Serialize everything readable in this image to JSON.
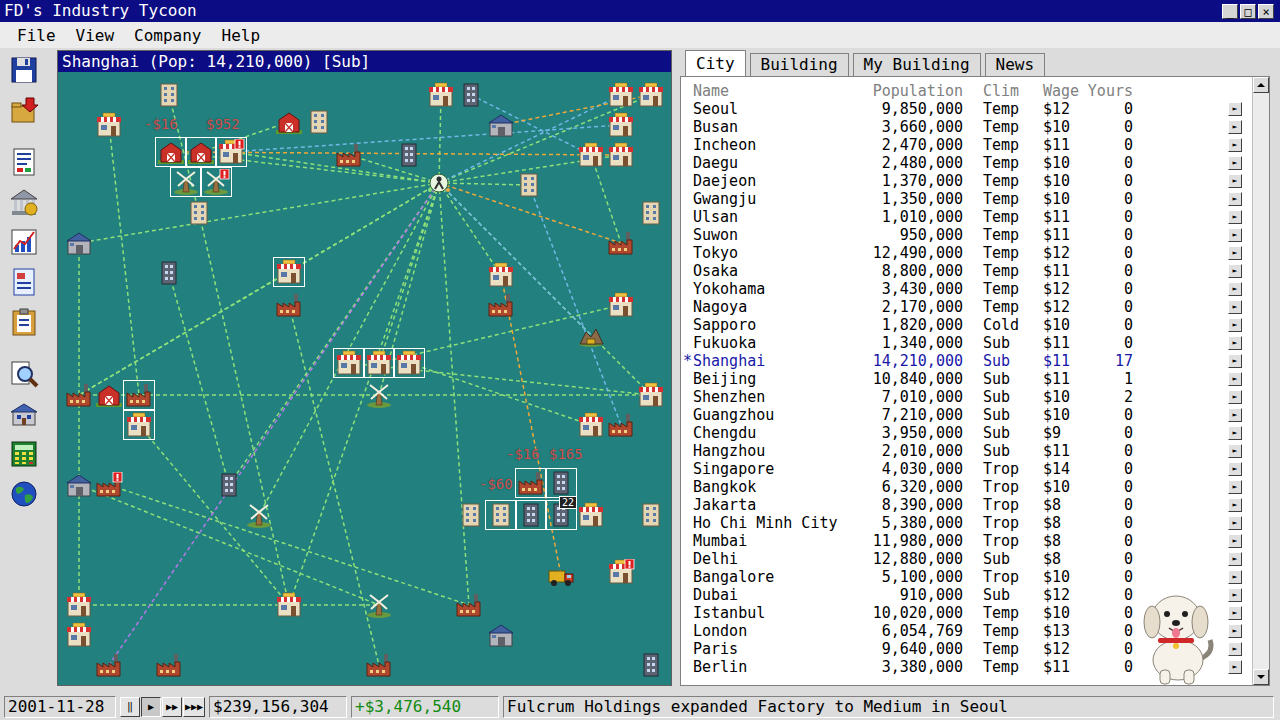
{
  "window": {
    "title": "FD's Industry Tycoon",
    "controls": [
      "_",
      "□",
      "×"
    ]
  },
  "menu": [
    "File",
    "View",
    "Company",
    "Help"
  ],
  "toolbar": [
    {
      "kind": "save"
    },
    {
      "kind": "load"
    },
    {
      "kind": "report"
    },
    {
      "kind": "bank"
    },
    {
      "kind": "chart"
    },
    {
      "kind": "document"
    },
    {
      "kind": "clipboard"
    },
    {
      "kind": "inspect"
    },
    {
      "kind": "school"
    },
    {
      "kind": "calculator"
    },
    {
      "kind": "globe"
    }
  ],
  "map": {
    "title": "Shanghai (Pop: 14,210,000) [Sub]",
    "nodes": [
      {
        "kind": "office",
        "selected": false,
        "alert": false
      },
      {
        "kind": "store",
        "selected": false,
        "alert": false
      },
      {
        "kind": "farm",
        "selected": false,
        "alert": false
      },
      {
        "kind": "office",
        "selected": false,
        "alert": false
      },
      {
        "kind": "store",
        "selected": false,
        "alert": false
      },
      {
        "kind": "tower",
        "selected": false,
        "alert": false
      },
      {
        "kind": "warehouse",
        "selected": false,
        "alert": false
      },
      {
        "kind": "store",
        "selected": false,
        "alert": false
      },
      {
        "kind": "store",
        "selected": false,
        "alert": false
      },
      {
        "kind": "store",
        "selected": false,
        "alert": false
      },
      {
        "kind": "farm",
        "selected": true,
        "alert": false
      },
      {
        "kind": "farm",
        "selected": true,
        "alert": false
      },
      {
        "kind": "store",
        "selected": true,
        "alert": true
      },
      {
        "kind": "windmill",
        "selected": true,
        "alert": false
      },
      {
        "kind": "windmill",
        "selected": true,
        "alert": true
      },
      {
        "kind": "factory",
        "selected": false,
        "alert": false
      },
      {
        "kind": "tower",
        "selected": false,
        "alert": false
      },
      {
        "kind": "hub",
        "selected": false,
        "alert": false
      },
      {
        "kind": "store",
        "selected": false,
        "alert": false
      },
      {
        "kind": "store",
        "selected": false,
        "alert": false
      },
      {
        "kind": "office",
        "selected": false,
        "alert": false
      },
      {
        "kind": "office",
        "selected": false,
        "alert": false
      },
      {
        "kind": "factory",
        "selected": false,
        "alert": false
      },
      {
        "kind": "office",
        "selected": false,
        "alert": false
      },
      {
        "kind": "warehouse",
        "selected": false,
        "alert": false
      },
      {
        "kind": "store",
        "selected": true,
        "alert": false
      },
      {
        "kind": "tower",
        "selected": false,
        "alert": false
      },
      {
        "kind": "store",
        "selected": false,
        "alert": false
      },
      {
        "kind": "factory",
        "selected": false,
        "alert": false
      },
      {
        "kind": "factory",
        "selected": false,
        "alert": false
      },
      {
        "kind": "store",
        "selected": false,
        "alert": false
      },
      {
        "kind": "mine",
        "selected": false,
        "alert": false
      },
      {
        "kind": "store",
        "selected": true,
        "alert": false
      },
      {
        "kind": "store",
        "selected": true,
        "alert": false
      },
      {
        "kind": "store",
        "selected": true,
        "alert": false
      },
      {
        "kind": "windmill",
        "selected": false,
        "alert": false
      },
      {
        "kind": "factory",
        "selected": false,
        "alert": false
      },
      {
        "kind": "farm",
        "selected": false,
        "alert": false
      },
      {
        "kind": "factory",
        "selected": true,
        "alert": false
      },
      {
        "kind": "store",
        "selected": true,
        "alert": false
      },
      {
        "kind": "store",
        "selected": false,
        "alert": false
      },
      {
        "kind": "store",
        "selected": false,
        "alert": false
      },
      {
        "kind": "factory",
        "selected": false,
        "alert": false
      },
      {
        "kind": "warehouse",
        "selected": false,
        "alert": false
      },
      {
        "kind": "factory",
        "selected": false,
        "alert": true
      },
      {
        "kind": "tower",
        "selected": false,
        "alert": false
      },
      {
        "kind": "windmill",
        "selected": false,
        "alert": false
      },
      {
        "kind": "factory",
        "selected": true,
        "alert": false
      },
      {
        "kind": "tower",
        "selected": true,
        "alert": false
      },
      {
        "kind": "office",
        "selected": false,
        "alert": false
      },
      {
        "kind": "office",
        "selected": true,
        "alert": false
      },
      {
        "kind": "tower",
        "selected": true,
        "alert": false
      },
      {
        "kind": "tower",
        "selected": true,
        "alert": false,
        "badge": "22"
      },
      {
        "kind": "store",
        "selected": false,
        "alert": false
      },
      {
        "kind": "office",
        "selected": false,
        "alert": false
      },
      {
        "kind": "truck",
        "selected": false,
        "alert": false
      },
      {
        "kind": "store",
        "selected": false,
        "alert": true
      },
      {
        "kind": "store",
        "selected": false,
        "alert": false
      },
      {
        "kind": "store",
        "selected": false,
        "alert": false
      },
      {
        "kind": "store",
        "selected": false,
        "alert": false
      },
      {
        "kind": "windmill",
        "selected": false,
        "alert": false
      },
      {
        "kind": "factory",
        "selected": false,
        "alert": false
      },
      {
        "kind": "warehouse",
        "selected": false,
        "alert": false
      },
      {
        "kind": "factory",
        "selected": false,
        "alert": false
      },
      {
        "kind": "factory",
        "selected": false,
        "alert": false
      },
      {
        "kind": "factory",
        "selected": false,
        "alert": false
      },
      {
        "kind": "tower",
        "selected": false,
        "alert": false
      }
    ],
    "routes": [
      {
        "from": 17,
        "to": 4,
        "color": "#8ee07a"
      },
      {
        "from": 17,
        "to": 10,
        "color": "#8ee07a"
      },
      {
        "from": 17,
        "to": 12,
        "color": "#8ee07a"
      },
      {
        "from": 17,
        "to": 15,
        "color": "#8ee07a"
      },
      {
        "from": 17,
        "to": 20,
        "color": "#8ee07a"
      },
      {
        "from": 17,
        "to": 25,
        "color": "#8ee07a"
      },
      {
        "from": 17,
        "to": 27,
        "color": "#8ee07a"
      },
      {
        "from": 17,
        "to": 33,
        "color": "#8ee07a"
      },
      {
        "from": 17,
        "to": 35,
        "color": "#8ee07a"
      },
      {
        "from": 17,
        "to": 45,
        "color": "#8ee07a"
      },
      {
        "from": 17,
        "to": 46,
        "color": "#8ee07a"
      },
      {
        "from": 17,
        "to": 59,
        "color": "#8ee07a"
      },
      {
        "from": 17,
        "to": 61,
        "color": "#8ee07a"
      },
      {
        "from": 17,
        "to": 36,
        "color": "#8ee07a"
      },
      {
        "from": 17,
        "to": 24,
        "color": "#8ee07a"
      },
      {
        "from": 17,
        "to": 19,
        "color": "#8ee07a"
      },
      {
        "from": 17,
        "to": 8,
        "color": "#8ee07a"
      },
      {
        "from": 17,
        "to": 40,
        "color": "#8ee07a"
      },
      {
        "from": 1,
        "to": 38,
        "color": "#8ee07a"
      },
      {
        "from": 0,
        "to": 21,
        "color": "#8ee07a"
      },
      {
        "from": 2,
        "to": 11,
        "color": "#8ee07a"
      },
      {
        "from": 25,
        "to": 36,
        "color": "#8ee07a"
      },
      {
        "from": 24,
        "to": 57,
        "color": "#8ee07a"
      },
      {
        "from": 36,
        "to": 40,
        "color": "#8ee07a"
      },
      {
        "from": 39,
        "to": 59,
        "color": "#8ee07a"
      },
      {
        "from": 32,
        "to": 40,
        "color": "#8ee07a"
      },
      {
        "from": 33,
        "to": 30,
        "color": "#8ee07a"
      },
      {
        "from": 18,
        "to": 22,
        "color": "#8ee07a"
      },
      {
        "from": 29,
        "to": 65,
        "color": "#8ee07a"
      },
      {
        "from": 43,
        "to": 60,
        "color": "#8ee07a"
      },
      {
        "from": 44,
        "to": 61,
        "color": "#8ee07a"
      },
      {
        "from": 57,
        "to": 60,
        "color": "#8ee07a"
      },
      {
        "from": 21,
        "to": 59,
        "color": "#8ee07a"
      },
      {
        "from": 26,
        "to": 45,
        "color": "#8ee07a"
      },
      {
        "from": 34,
        "to": 41,
        "color": "#8ee07a"
      },
      {
        "from": 17,
        "to": 7,
        "color": "#70b8e8"
      },
      {
        "from": 12,
        "to": 9,
        "color": "#70b8e8"
      },
      {
        "from": 17,
        "to": 31,
        "color": "#70b8e8"
      },
      {
        "from": 20,
        "to": 42,
        "color": "#70b8e8"
      },
      {
        "from": 5,
        "to": 18,
        "color": "#70b8e8"
      },
      {
        "from": 17,
        "to": 22,
        "color": "#f0a838"
      },
      {
        "from": 10,
        "to": 19,
        "color": "#f0a838"
      },
      {
        "from": 27,
        "to": 55,
        "color": "#f0a838"
      },
      {
        "from": 6,
        "to": 8,
        "color": "#f0a838"
      },
      {
        "from": 17,
        "to": 63,
        "color": "#b478e8"
      }
    ],
    "labels": [
      {
        "text": "-$16",
        "color": "#d05050"
      },
      {
        "text": "$952",
        "color": "#d05050"
      },
      {
        "text": "-$16",
        "color": "#d05050"
      },
      {
        "text": "$165",
        "color": "#d05050"
      },
      {
        "text": "-$60",
        "color": "#d05050"
      }
    ]
  },
  "tabs": [
    {
      "label": "City",
      "selected": true
    },
    {
      "label": "Building",
      "selected": false
    },
    {
      "label": "My Building",
      "selected": false
    },
    {
      "label": "News",
      "selected": false
    }
  ],
  "table": {
    "columns": [
      "Name",
      "Population",
      "Clim",
      "Wage",
      "Yours"
    ],
    "row_button": "►",
    "rows": [
      {
        "marker": "",
        "name": "Seoul",
        "population": "9,850,000",
        "climate": "Temp",
        "wage": "$12",
        "yours": "0",
        "selected": false
      },
      {
        "marker": "",
        "name": "Busan",
        "population": "3,660,000",
        "climate": "Temp",
        "wage": "$10",
        "yours": "0",
        "selected": false
      },
      {
        "marker": "",
        "name": "Incheon",
        "population": "2,470,000",
        "climate": "Temp",
        "wage": "$11",
        "yours": "0",
        "selected": false
      },
      {
        "marker": "",
        "name": "Daegu",
        "population": "2,480,000",
        "climate": "Temp",
        "wage": "$10",
        "yours": "0",
        "selected": false
      },
      {
        "marker": "",
        "name": "Daejeon",
        "population": "1,370,000",
        "climate": "Temp",
        "wage": "$10",
        "yours": "0",
        "selected": false
      },
      {
        "marker": "",
        "name": "Gwangju",
        "population": "1,350,000",
        "climate": "Temp",
        "wage": "$10",
        "yours": "0",
        "selected": false
      },
      {
        "marker": "",
        "name": "Ulsan",
        "population": "1,010,000",
        "climate": "Temp",
        "wage": "$11",
        "yours": "0",
        "selected": false
      },
      {
        "marker": "",
        "name": "Suwon",
        "population": "950,000",
        "climate": "Temp",
        "wage": "$11",
        "yours": "0",
        "selected": false
      },
      {
        "marker": "",
        "name": "Tokyo",
        "population": "12,490,000",
        "climate": "Temp",
        "wage": "$12",
        "yours": "0",
        "selected": false
      },
      {
        "marker": "",
        "name": "Osaka",
        "population": "8,800,000",
        "climate": "Temp",
        "wage": "$11",
        "yours": "0",
        "selected": false
      },
      {
        "marker": "",
        "name": "Yokohama",
        "population": "3,430,000",
        "climate": "Temp",
        "wage": "$12",
        "yours": "0",
        "selected": false
      },
      {
        "marker": "",
        "name": "Nagoya",
        "population": "2,170,000",
        "climate": "Temp",
        "wage": "$12",
        "yours": "0",
        "selected": false
      },
      {
        "marker": "",
        "name": "Sapporo",
        "population": "1,820,000",
        "climate": "Cold",
        "wage": "$10",
        "yours": "0",
        "selected": false
      },
      {
        "marker": "",
        "name": "Fukuoka",
        "population": "1,340,000",
        "climate": "Sub",
        "wage": "$11",
        "yours": "0",
        "selected": false
      },
      {
        "marker": "*",
        "name": "Shanghai",
        "population": "14,210,000",
        "climate": "Sub",
        "wage": "$11",
        "yours": "17",
        "selected": true
      },
      {
        "marker": "",
        "name": "Beijing",
        "population": "10,840,000",
        "climate": "Sub",
        "wage": "$11",
        "yours": "1",
        "selected": false
      },
      {
        "marker": "",
        "name": "Shenzhen",
        "population": "7,010,000",
        "climate": "Sub",
        "wage": "$10",
        "yours": "2",
        "selected": false
      },
      {
        "marker": "",
        "name": "Guangzhou",
        "population": "7,210,000",
        "climate": "Sub",
        "wage": "$10",
        "yours": "0",
        "selected": false
      },
      {
        "marker": "",
        "name": "Chengdu",
        "population": "3,950,000",
        "climate": "Sub",
        "wage": "$9",
        "yours": "0",
        "selected": false
      },
      {
        "marker": "",
        "name": "Hangzhou",
        "population": "2,010,000",
        "climate": "Sub",
        "wage": "$11",
        "yours": "0",
        "selected": false
      },
      {
        "marker": "",
        "name": "Singapore",
        "population": "4,030,000",
        "climate": "Trop",
        "wage": "$14",
        "yours": "0",
        "selected": false
      },
      {
        "marker": "",
        "name": "Bangkok",
        "population": "6,320,000",
        "climate": "Trop",
        "wage": "$10",
        "yours": "0",
        "selected": false
      },
      {
        "marker": "",
        "name": "Jakarta",
        "population": "8,390,000",
        "climate": "Trop",
        "wage": "$8",
        "yours": "0",
        "selected": false
      },
      {
        "marker": "",
        "name": "Ho Chi Minh City",
        "population": "5,380,000",
        "climate": "Trop",
        "wage": "$8",
        "yours": "0",
        "selected": false
      },
      {
        "marker": "",
        "name": "Mumbai",
        "population": "11,980,000",
        "climate": "Trop",
        "wage": "$8",
        "yours": "0",
        "selected": false
      },
      {
        "marker": "",
        "name": "Delhi",
        "population": "12,880,000",
        "climate": "Sub",
        "wage": "$8",
        "yours": "0",
        "selected": false
      },
      {
        "marker": "",
        "name": "Bangalore",
        "population": "5,100,000",
        "climate": "Trop",
        "wage": "$10",
        "yours": "0",
        "selected": false
      },
      {
        "marker": "",
        "name": "Dubai",
        "population": "910,000",
        "climate": "Sub",
        "wage": "$12",
        "yours": "0",
        "selected": false
      },
      {
        "marker": "",
        "name": "Istanbul",
        "population": "10,020,000",
        "climate": "Temp",
        "wage": "$10",
        "yours": "0",
        "selected": false
      },
      {
        "marker": "",
        "name": "London",
        "population": "6,054,769",
        "climate": "Temp",
        "wage": "$13",
        "yours": "0",
        "selected": false
      },
      {
        "marker": "",
        "name": "Paris",
        "population": "9,640,000",
        "climate": "Temp",
        "wage": "$12",
        "yours": "0",
        "selected": false
      },
      {
        "marker": "",
        "name": "Berlin",
        "population": "3,380,000",
        "climate": "Temp",
        "wage": "$11",
        "yours": "0",
        "selected": false
      }
    ]
  },
  "status_bar": {
    "date": "2001-11-28",
    "speed_buttons": [
      {
        "label": "‖",
        "selected": false
      },
      {
        "label": "▶",
        "selected": true
      },
      {
        "label": "▶▶",
        "selected": false
      },
      {
        "label": "▶▶▶",
        "selected": false
      }
    ],
    "cash": "$239,156,304",
    "income": "+$3,476,540",
    "message": "Fulcrum Holdings expanded Factory to Medium in Seoul"
  }
}
